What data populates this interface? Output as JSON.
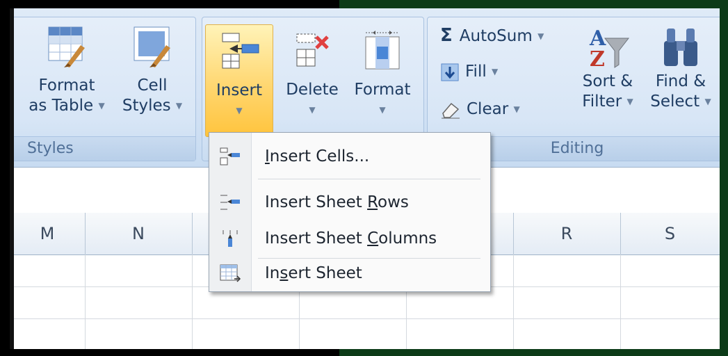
{
  "ribbon": {
    "styles_group": {
      "label": "Styles",
      "format_as_table": {
        "line1": "Format",
        "line2": "as Table"
      },
      "cell_styles": {
        "line1": "Cell",
        "line2": "Styles"
      }
    },
    "cells_group": {
      "insert": {
        "label": "Insert",
        "state": "active"
      },
      "delete": {
        "label": "Delete"
      },
      "format": {
        "label": "Format"
      }
    },
    "editing_group": {
      "label": "Editing",
      "autosum": "AutoSum",
      "fill": "Fill",
      "clear": "Clear",
      "sort_filter": {
        "line1": "Sort &",
        "line2": "Filter"
      },
      "find_select": {
        "line1": "Find &",
        "line2": "Select"
      }
    }
  },
  "columns": [
    "M",
    "N",
    "R",
    "S"
  ],
  "insert_menu": {
    "items": [
      {
        "pre": "",
        "u": "I",
        "post": "nsert Cells...",
        "icon": "insert-cells-icon"
      },
      {
        "pre": "Insert Sheet ",
        "u": "R",
        "post": "ows",
        "icon": "insert-rows-icon"
      },
      {
        "pre": "Insert Sheet ",
        "u": "C",
        "post": "olumns",
        "icon": "insert-columns-icon"
      },
      {
        "pre": "In",
        "u": "s",
        "post": "ert Sheet",
        "icon": "insert-sheet-icon"
      }
    ]
  },
  "colors": {
    "ribbon_bg": "#d4e3f5",
    "active_button": "#ffd46a",
    "frame_green": "#0c3b18"
  }
}
